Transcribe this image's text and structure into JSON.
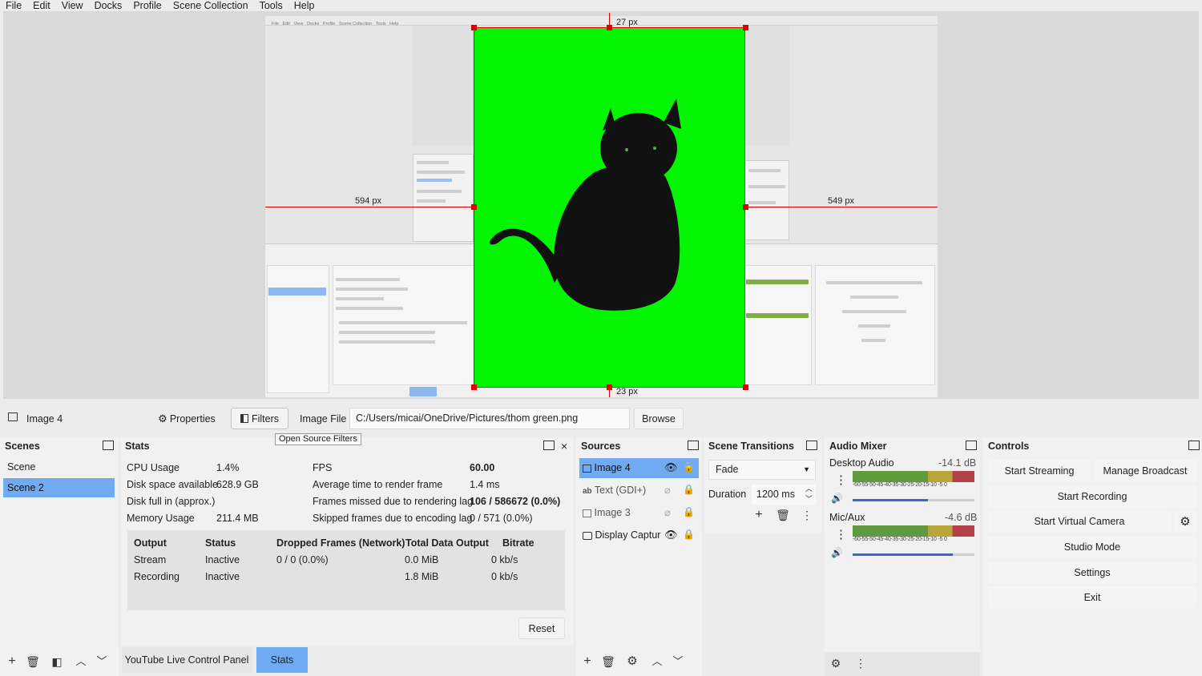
{
  "menu": [
    "File",
    "Edit",
    "View",
    "Docks",
    "Profile",
    "Scene Collection",
    "Tools",
    "Help"
  ],
  "preview": {
    "dim_top": "27 px",
    "dim_left": "594 px",
    "dim_right": "549 px",
    "dim_bottom": "23 px",
    "background_color": "#03f503",
    "guide_color": "#e00000"
  },
  "source_toolbar": {
    "source_name": "Image 4",
    "properties_label": "Properties",
    "filters_label": "Filters",
    "image_file_label": "Image File",
    "path": "C:/Users/micai/OneDrive/Pictures/thom green.png",
    "browse_label": "Browse",
    "tooltip": "Open Source Filters"
  },
  "scenes": {
    "title": "Scenes",
    "items": [
      "Scene",
      "Scene 2"
    ],
    "selected": "Scene 2"
  },
  "stats": {
    "title": "Stats",
    "left": [
      {
        "label": "CPU Usage",
        "value": "1.4%"
      },
      {
        "label": "Disk space available",
        "value": "628.9 GB"
      },
      {
        "label": "Disk full in (approx.)",
        "value": ""
      },
      {
        "label": "Memory Usage",
        "value": "211.4 MB"
      }
    ],
    "right": [
      {
        "label": "FPS",
        "value": "60.00"
      },
      {
        "label": "Average time to render frame",
        "value": "1.4 ms"
      },
      {
        "label": "Frames missed due to rendering lag",
        "value": "106 / 586672 (0.0%)"
      },
      {
        "label": "Skipped frames due to encoding lag",
        "value": "0 / 571 (0.0%)"
      }
    ],
    "table_headers": [
      "Output",
      "Status",
      "Dropped Frames (Network)",
      "Total Data Output",
      "Bitrate"
    ],
    "rows": [
      [
        "Stream",
        "Inactive",
        "0 / 0 (0.0%)",
        "0.0 MiB",
        "0 kb/s"
      ],
      [
        "Recording",
        "Inactive",
        "",
        "1.8 MiB",
        "0 kb/s"
      ]
    ],
    "reset_label": "Reset"
  },
  "bottom_tabs": {
    "youtube": "YouTube Live Control Panel",
    "stats": "Stats"
  },
  "sources": {
    "title": "Sources",
    "items": [
      {
        "name": "Image 4",
        "icon": "image-icon",
        "visible": true
      },
      {
        "name": "Text (GDI+)",
        "icon": "text-icon",
        "visible": false
      },
      {
        "name": "Image 3",
        "icon": "image-icon",
        "visible": false
      },
      {
        "name": "Display Captur",
        "icon": "monitor-icon",
        "visible": true
      }
    ]
  },
  "transitions": {
    "title": "Scene Transitions",
    "selected": "Fade",
    "duration_label": "Duration",
    "duration_value": "1200 ms"
  },
  "mixer": {
    "title": "Audio Mixer",
    "channels": [
      {
        "name": "Desktop Audio",
        "db": "-14.1 dB",
        "volume": 0.62
      },
      {
        "name": "Mic/Aux",
        "db": "-4.6 dB",
        "volume": 0.82
      }
    ],
    "scale": "-60-55-50-45-40-35-30-25-20-15-10 -5  0"
  },
  "controls": {
    "title": "Controls",
    "start_streaming": "Start Streaming",
    "manage_broadcast": "Manage Broadcast",
    "start_recording": "Start Recording",
    "start_virtual_camera": "Start Virtual Camera",
    "studio_mode": "Studio Mode",
    "settings": "Settings",
    "exit": "Exit"
  }
}
